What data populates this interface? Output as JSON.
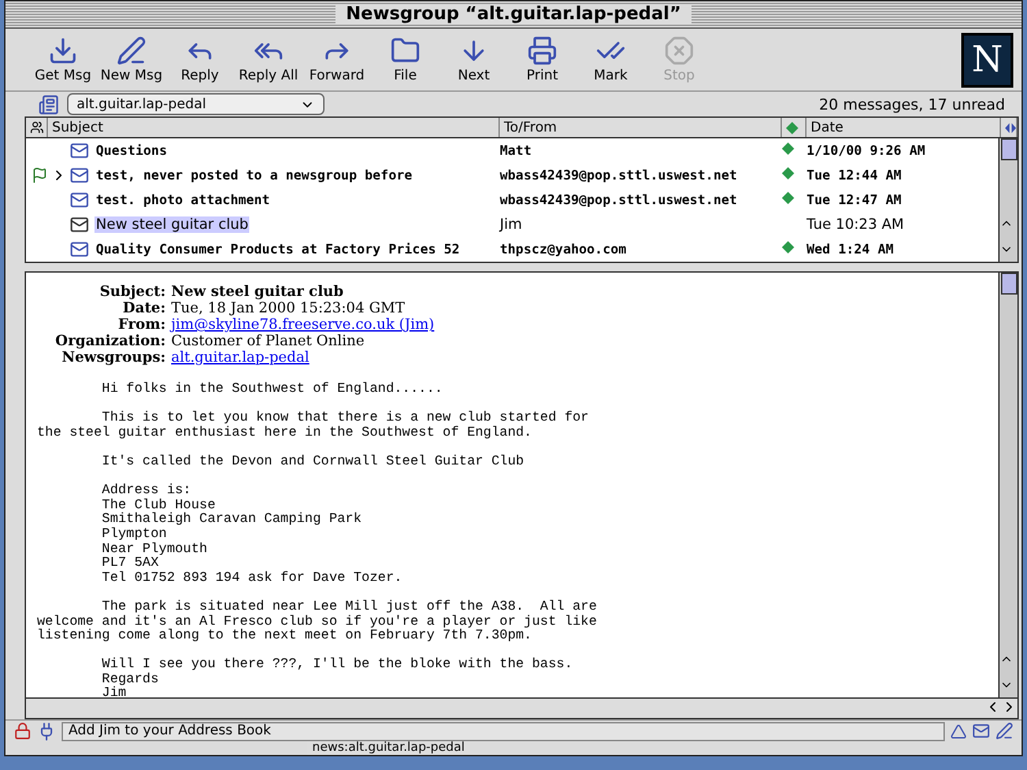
{
  "window": {
    "title": "Newsgroup “alt.guitar.lap-pedal”"
  },
  "toolbar": [
    {
      "label": "Get Msg",
      "disabled": false
    },
    {
      "label": "New Msg",
      "disabled": false
    },
    {
      "label": "Reply",
      "disabled": false
    },
    {
      "label": "Reply All",
      "disabled": false
    },
    {
      "label": "Forward",
      "disabled": false
    },
    {
      "label": "File",
      "disabled": false
    },
    {
      "label": "Next",
      "disabled": false
    },
    {
      "label": "Print",
      "disabled": false
    },
    {
      "label": "Mark",
      "disabled": false
    },
    {
      "label": "Stop",
      "disabled": true
    }
  ],
  "logo": {
    "text": "N"
  },
  "location": {
    "folder": "alt.guitar.lap-pedal",
    "summary": "20 messages, 17 unread"
  },
  "table": {
    "columns": [
      "Subject",
      "To/From",
      "Date"
    ],
    "rows": [
      {
        "subject": "Questions",
        "from": "Matt",
        "date": "1/10/00 9:26 AM",
        "unread": true,
        "selected": false,
        "flagged": false,
        "expandable": false
      },
      {
        "subject": "test, never posted to a newsgroup before",
        "from": "wbass42439@pop.sttl.uswest.net",
        "date": "Tue 12:44 AM",
        "unread": true,
        "selected": false,
        "flagged": true,
        "expandable": true
      },
      {
        "subject": "test. photo attachment",
        "from": "wbass42439@pop.sttl.uswest.net",
        "date": "Tue 12:47 AM",
        "unread": true,
        "selected": false,
        "flagged": false,
        "expandable": false
      },
      {
        "subject": "New steel guitar club",
        "from": "Jim",
        "date": "Tue 10:23 AM",
        "unread": false,
        "selected": true,
        "flagged": false,
        "expandable": false
      },
      {
        "subject": "Quality Consumer Products at Factory Prices  52",
        "from": "thpscz@yahoo.com",
        "date": "Wed 1:24 AM",
        "unread": true,
        "selected": false,
        "flagged": false,
        "expandable": false
      }
    ]
  },
  "message": {
    "headers": [
      {
        "label": "Subject:",
        "value": "New steel guitar club",
        "link": false,
        "bold": true
      },
      {
        "label": "Date:",
        "value": "Tue, 18 Jan 2000 15:23:04 GMT",
        "link": false,
        "bold": false
      },
      {
        "label": "From:",
        "value": "jim@skyline78.freeserve.co.uk (Jim)",
        "link": true,
        "bold": false
      },
      {
        "label": "Organization:",
        "value": "Customer of Planet Online",
        "link": false,
        "bold": false
      },
      {
        "label": "Newsgroups:",
        "value": "alt.guitar.lap-pedal",
        "link": true,
        "bold": false
      }
    ],
    "body": [
      "        Hi folks in the Southwest of England......",
      "        This is to let you know that there is a new club started for\nthe steel guitar enthusiast here in the Southwest of England.",
      "        It's called the Devon and Cornwall Steel Guitar Club",
      "        Address is:\n        The Club House\n        Smithaleigh Caravan Camping Park\n        Plympton\n        Near Plymouth\n        PL7 5AX\n        Tel 01752 893 194 ask for Dave Tozer.",
      "        The park is situated near Lee Mill just off the A38.  All are\nwelcome and it's an Al Fresco club so if you're a player or just like\nlistening come along to the next meet on February 7th 7.30pm.",
      "        Will I see you there ???, I'll be the bloke with the bass.\n        Regards\n        Jim"
    ]
  },
  "status_bar": {
    "text": "Add Jim to your Address Book"
  },
  "taskbar": {
    "text": "news:alt.guitar.lap-pedal"
  }
}
